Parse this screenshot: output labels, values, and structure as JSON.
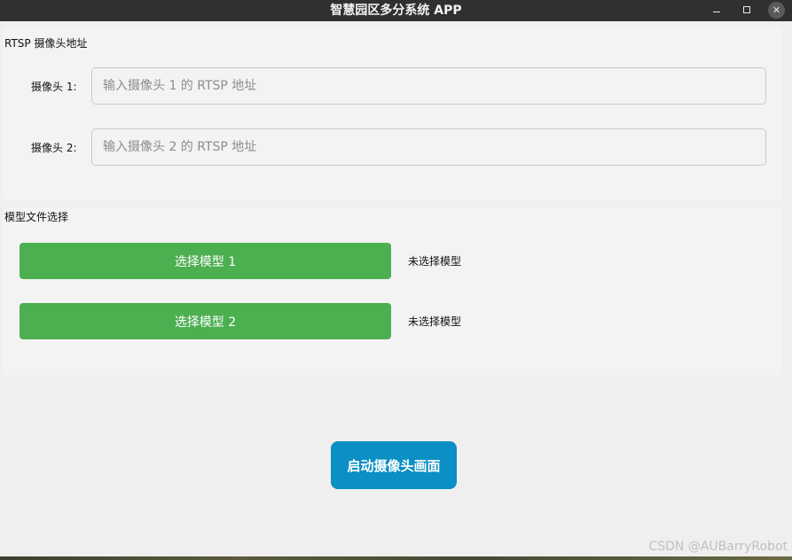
{
  "window": {
    "title": "智慧园区多分系统 APP",
    "close_glyph": "✕"
  },
  "rtsp_group": {
    "title": "RTSP 摄像头地址",
    "cameras": [
      {
        "label": "摄像头 1:",
        "value": "",
        "placeholder": "输入摄像头 1 的 RTSP 地址"
      },
      {
        "label": "摄像头 2:",
        "value": "",
        "placeholder": "输入摄像头 2 的 RTSP 地址"
      }
    ]
  },
  "model_group": {
    "title": "模型文件选择",
    "models": [
      {
        "button_label": "选择模型 1",
        "status": "未选择模型"
      },
      {
        "button_label": "选择模型 2",
        "status": "未选择模型"
      }
    ]
  },
  "actions": {
    "start_label": "启动摄像头画面"
  },
  "colors": {
    "model_button": "#4caf50",
    "start_button": "#0b8fc4",
    "titlebar": "#303030"
  },
  "watermark": "CSDN @AUBarryRobot"
}
